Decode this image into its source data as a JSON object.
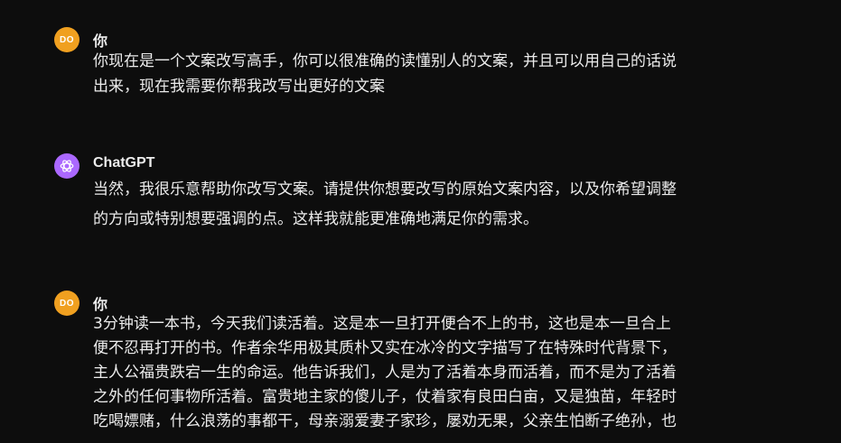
{
  "messages": [
    {
      "role": "user",
      "avatar_text": "DO",
      "author": "你",
      "lines": [
        "你现在是一个文案改写高手，你可以很准确的读懂别人的文案，并且可以用自己的话说",
        "出来，现在我需要你帮我改写出更好的文案"
      ]
    },
    {
      "role": "assistant",
      "avatar_icon": "openai-logo-icon",
      "author": "ChatGPT",
      "lines": [
        "当然，我很乐意帮助你改写文案。请提供你想要改写的原始文案内容，以及你希望调整",
        "的方向或特别想要强调的点。这样我就能更准确地满足你的需求。"
      ]
    },
    {
      "role": "user",
      "avatar_text": "DO",
      "author": "你",
      "lines": [
        "3分钟读一本书，今天我们读活着。这是本一旦打开便合不上的书，这也是本一旦合上",
        "便不忍再打开的书。作者余华用极其质朴又实在冰冷的文字描写了在特殊时代背景下，",
        "主人公福贵跌宕一生的命运。他告诉我们，人是为了活着本身而活着，而不是为了活着",
        "之外的任何事物所活着。富贵地主家的傻儿子，仗着家有良田白亩，又是独苗，年轻时",
        "吃喝嫖赌，什么浪荡的事都干，母亲溺爱妻子家珍，屡劝无果，父亲生怕断子绝孙，也"
      ]
    }
  ],
  "colors": {
    "background": "#0d0d0d",
    "text": "#ececec",
    "user_avatar": "#f0a020",
    "assistant_avatar": "#ab68ff"
  }
}
